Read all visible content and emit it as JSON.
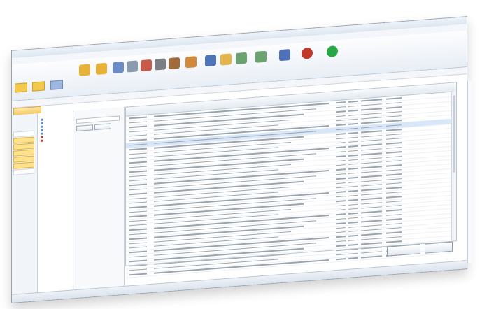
{
  "window": {
    "title": ""
  },
  "menu": [],
  "toolbar": {
    "buttons": [
      {
        "label": "",
        "icon": "folder-icon",
        "color": "#e8b23a"
      },
      {
        "label": "",
        "icon": "open-icon",
        "color": "#e8b23a"
      },
      {
        "label": "",
        "icon": "book-icon",
        "color": "#6b8cc7"
      },
      {
        "label": "",
        "icon": "chart-icon",
        "color": "#8a9bb0"
      },
      {
        "label": "",
        "icon": "document-icon",
        "color": "#c65b4a"
      },
      {
        "label": "",
        "icon": "gear-icon",
        "color": "#7a7f86"
      },
      {
        "label": "",
        "icon": "people-icon",
        "color": "#a06a3b"
      },
      {
        "label": "",
        "icon": "figure-icon",
        "color": "#d08a3a"
      },
      {
        "label": "",
        "icon": "stack-icon",
        "color": "#4f74b8"
      },
      {
        "label": "",
        "icon": "folder-icon",
        "color": "#e2b44a"
      },
      {
        "label": "",
        "icon": "table-icon",
        "color": "#6aa36f"
      },
      {
        "label": "",
        "icon": "grid-icon",
        "color": "#6aa36f"
      },
      {
        "label": "",
        "icon": "key-icon",
        "color": "#4f6fb8"
      },
      {
        "label": "",
        "icon": "stop-icon",
        "color": "#c0392b"
      },
      {
        "label": "",
        "icon": "go-icon",
        "color": "#27a844"
      }
    ]
  },
  "doc_tab": {
    "label": ""
  },
  "grid": {
    "columns": [
      "",
      "",
      "",
      "",
      "",
      ""
    ],
    "rows_count_hint": 36
  },
  "footer": {
    "left_button": "",
    "right_button": ""
  },
  "status": {
    "text": ""
  },
  "colors": {
    "accent": "#f6c85f",
    "selection": "#d7e6f8",
    "ribbon": "#e8eef5"
  }
}
